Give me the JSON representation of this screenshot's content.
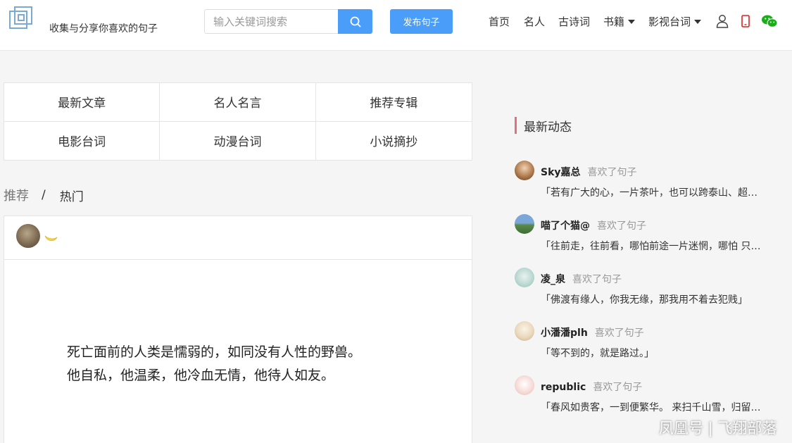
{
  "header": {
    "tagline": "收集与分享你喜欢的句子",
    "search_placeholder": "输入关键词搜索",
    "publish_label": "发布句子",
    "nav": [
      {
        "label": "首页"
      },
      {
        "label": "名人"
      },
      {
        "label": "古诗词"
      },
      {
        "label": "书籍",
        "has_dropdown": true
      },
      {
        "label": "影视台词",
        "has_dropdown": true
      }
    ],
    "icons": [
      "user-icon",
      "phone-icon",
      "wechat-icon"
    ]
  },
  "categories": [
    "最新文章",
    "名人名言",
    "推荐专辑",
    "电影台词",
    "动漫台词",
    "小说摘抄"
  ],
  "tabs": {
    "recommend": "推荐",
    "separator": "/",
    "hot": "热门"
  },
  "post": {
    "quote_line1": "死亡面前的人类是懦弱的，如同没有人性的野兽。",
    "quote_line2": "他自私，他温柔，他冷血无情，他待人如友。"
  },
  "sidebar": {
    "title": "最新动态",
    "activities": [
      {
        "user": "Sky嘉总",
        "action": "喜欢了句子",
        "text": "「若有广大的心，一片茶叶，也可以跨泰山、超…"
      },
      {
        "user": "喵了个猫@",
        "action": "喜欢了句子",
        "text": "「往前走，往前看，哪怕前途一片迷惘，哪怕 只…"
      },
      {
        "user": "凌_泉",
        "action": "喜欢了句子",
        "text": "「佛渡有缘人，你我无缘，那我用不着去犯贱」"
      },
      {
        "user": "小潘潘plh",
        "action": "喜欢了句子",
        "text": "「等不到的，就是路过。」"
      },
      {
        "user": "republic",
        "action": "喜欢了句子",
        "text": "「春风如贵客，一到便繁华。 来扫千山雪，归留…"
      }
    ]
  },
  "watermark": "凤凰号 | 飞翔部落",
  "colors": {
    "accent": "#4a9df8",
    "sidebar_marker": "#e0707a"
  }
}
